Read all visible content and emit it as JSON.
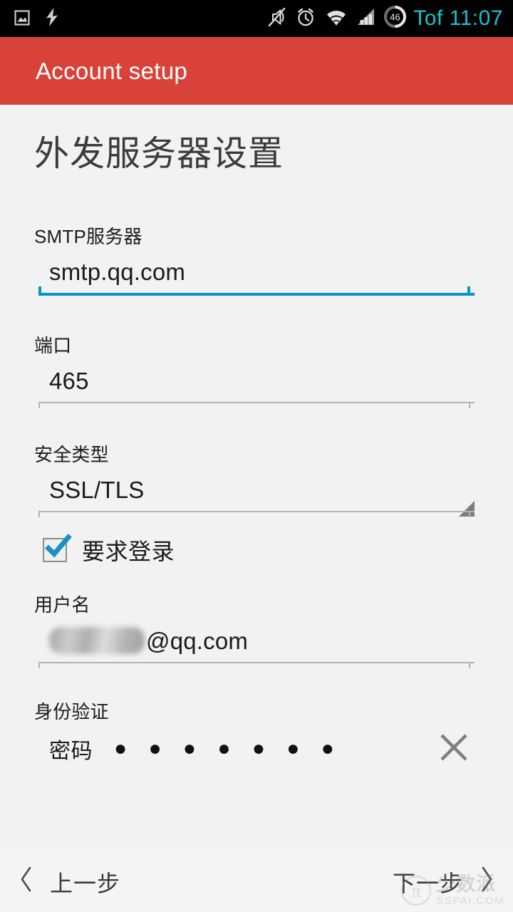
{
  "status_bar": {
    "left_icons": [
      {
        "name": "screenshot-icon",
        "glyph": "image"
      },
      {
        "name": "lightning-bolt-icon",
        "glyph": "bolt"
      }
    ],
    "right_icons": [
      {
        "name": "mute-icon",
        "glyph": "bell-muted"
      },
      {
        "name": "alarm-clock-icon",
        "glyph": "alarm"
      },
      {
        "name": "wifi-icon",
        "glyph": "wifi"
      },
      {
        "name": "cellular-signal-icon",
        "glyph": "signal"
      },
      {
        "name": "battery-icon",
        "glyph": "battery-circle"
      }
    ],
    "battery_level": "46",
    "clock": "Tof 11:07",
    "clock_color": "#12c5cf",
    "background": "#000000"
  },
  "action_bar": {
    "title": "Account setup",
    "background": "#d94238",
    "text_color": "#ffffff"
  },
  "page": {
    "title": "外发服务器设置",
    "background": "#f2f2f2"
  },
  "fields": {
    "smtp_server": {
      "label": "SMTP服务器",
      "value": "smtp.qq.com",
      "placeholder": "",
      "focused": true,
      "underline_color": "#0098cc"
    },
    "port": {
      "label": "端口",
      "value": "465",
      "placeholder": "",
      "focused": false,
      "underline_color": "#b3b3b3"
    },
    "security_type": {
      "label": "安全类型",
      "value": "SSL/TLS",
      "options": [
        "SSL/TLS"
      ],
      "focused": false,
      "underline_color": "#b3b3b3"
    },
    "require_signin": {
      "label": "要求登录",
      "checked": true,
      "check_color": "#1a8fc4"
    },
    "username": {
      "label": "用户名",
      "value_redacted": true,
      "value_suffix": "@qq.com",
      "focused": false,
      "underline_color": "#b3b3b3"
    },
    "authentication": {
      "label": "身份验证",
      "method_label": "密码",
      "password_mask": "● ● ● ● ● ● ●",
      "clear_icon": "close-icon"
    }
  },
  "bottom_bar": {
    "previous": {
      "label": "上一步",
      "icon": "chevron-left-icon"
    },
    "next": {
      "label": "下一步",
      "icon": "chevron-right-icon"
    },
    "background": "#f4f4f4"
  },
  "watermark": {
    "logo": "π",
    "name_cn": "少数派",
    "name_en": "SSPAI.COM"
  }
}
